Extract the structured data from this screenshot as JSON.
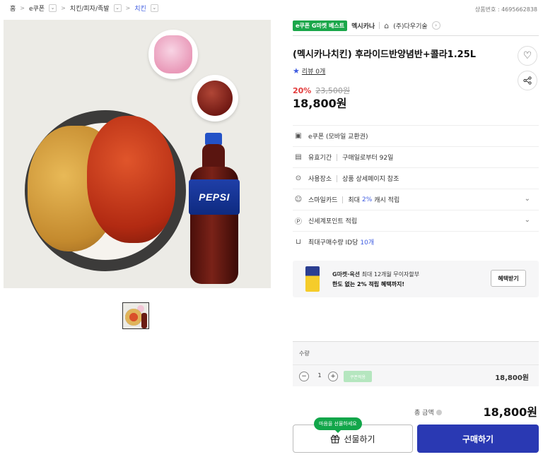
{
  "breadcrumb": {
    "items": [
      {
        "label": "홈",
        "dropdown": false
      },
      {
        "label": "e쿠폰",
        "dropdown": true
      },
      {
        "label": "치킨/피자/족발",
        "dropdown": true
      },
      {
        "label": "치킨",
        "dropdown": true,
        "current": true
      }
    ],
    "separator": ">"
  },
  "product_no": "상품번호 : 4695662838",
  "gallery": {
    "main_image_alt": "PEPSI",
    "thumbnails": 1
  },
  "seller": {
    "badge": "e쿠폰 G마켓 베스트",
    "brand": "멕시카나",
    "shop_name": "(주)다우기술",
    "shop_icon": "home-icon",
    "chevron": "›"
  },
  "product": {
    "title": "(멕시카나치킨) 후라이드반양념반+콜라1.25L",
    "review_label": "리뷰 0개",
    "discount_rate": "20%",
    "original_price": "23,500원",
    "price": "18,800원"
  },
  "info_rows": [
    {
      "icon": "coupon-icon",
      "glyph": "▣",
      "label": "e쿠폰 (모바일 교환권)",
      "value": "",
      "highlight": "",
      "suffix": "",
      "expandable": false
    },
    {
      "icon": "calendar-icon",
      "glyph": "▤",
      "label": "유효기간",
      "value": "구매일로부터 92일",
      "highlight": "",
      "suffix": "",
      "expandable": false
    },
    {
      "icon": "location-icon",
      "glyph": "⊙",
      "label": "사용장소",
      "value": "상품 상세페이지 참조",
      "highlight": "",
      "suffix": "",
      "expandable": false
    },
    {
      "icon": "smilecard-icon",
      "glyph": "☺",
      "label": "스마일카드",
      "value": "최대",
      "highlight": "2%",
      "suffix": "캐시 적립",
      "expandable": true
    },
    {
      "icon": "points-icon",
      "glyph": "Ⓟ",
      "label": "신세계포인트 적립",
      "value": "",
      "highlight": "",
      "suffix": "",
      "expandable": true
    },
    {
      "icon": "cart-icon",
      "glyph": "⊔",
      "label": "최대구매수량 ID당",
      "value": "",
      "highlight": "10개",
      "suffix": "",
      "expandable": false
    }
  ],
  "banner": {
    "line1_bold": "G마켓·옥션",
    "line1_rest": "최대 12개월 무이자할부",
    "line2": "한도 없는 2% 적립 혜택까지!",
    "button": "혜택받기"
  },
  "quantity": {
    "label": "수량",
    "minus": "−",
    "plus": "+",
    "value": "1",
    "coupon_chip": "쿠폰적용",
    "line_price": "18,800원"
  },
  "total": {
    "label": "총 금액",
    "price": "18,800원"
  },
  "actions": {
    "gift_bubble": "마음을 선물하세요",
    "gift_label": "선물하기",
    "gift_icon": "gift-icon",
    "buy_label": "구매하기"
  },
  "colors": {
    "accent_blue": "#2a39b3",
    "link_blue": "#3d5be0",
    "discount_red": "#e23b3b",
    "badge_green": "#1aa74a"
  }
}
